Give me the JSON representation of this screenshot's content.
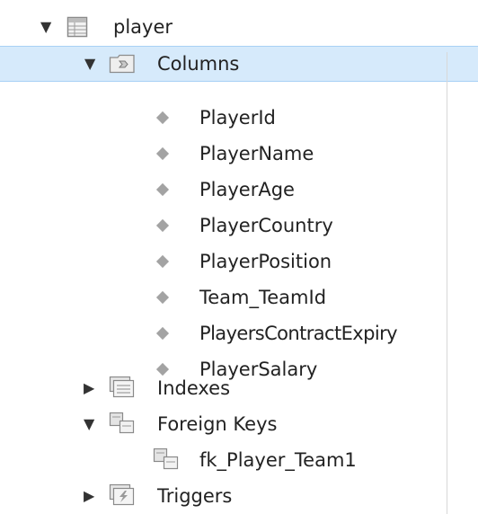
{
  "tree": {
    "table": {
      "label": "player",
      "expanded": true
    },
    "columns_folder": {
      "label": "Columns",
      "expanded": true,
      "selected": true
    },
    "columns": [
      {
        "label": "PlayerId"
      },
      {
        "label": "PlayerName"
      },
      {
        "label": "PlayerAge"
      },
      {
        "label": "PlayerCountry"
      },
      {
        "label": "PlayerPosition"
      },
      {
        "label": "Team_TeamId"
      },
      {
        "label": "PlayersContractExpiry"
      },
      {
        "label": "PlayerSalary"
      }
    ],
    "indexes_folder": {
      "label": "Indexes",
      "expanded": false
    },
    "foreign_keys_folder": {
      "label": "Foreign Keys",
      "expanded": true
    },
    "foreign_keys": [
      {
        "label": "fk_Player_Team1"
      }
    ],
    "triggers_folder": {
      "label": "Triggers",
      "expanded": false
    }
  },
  "colors": {
    "selection_bg": "#d6eafb",
    "selection_border": "#a9d1f5",
    "text": "#222222",
    "column_diamond": "#a3a3a3"
  }
}
